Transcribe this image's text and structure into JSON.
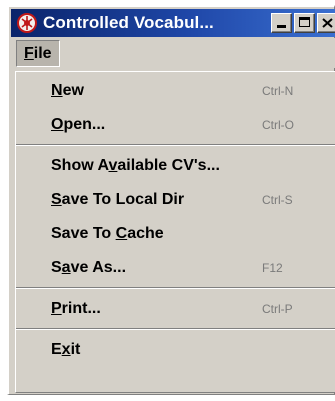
{
  "window": {
    "title": "Controlled Vocabul...",
    "colors": {
      "titlebar": "#0a246a",
      "face": "#d4d0c8",
      "accelerator": "#7a7a7a"
    }
  },
  "menubar": {
    "file_menu": {
      "before": "",
      "mnemonic": "F",
      "after": "ile"
    }
  },
  "file_menu_items": [
    {
      "before": "",
      "mnemonic": "N",
      "after": "ew",
      "accelerator": "Ctrl-N"
    },
    {
      "before": "",
      "mnemonic": "O",
      "after": "pen...",
      "accelerator": "Ctrl-O"
    },
    {
      "before": "Show A",
      "mnemonic": "v",
      "after": "ailable CV's...",
      "accelerator": ""
    },
    {
      "before": "",
      "mnemonic": "S",
      "after": "ave To Local Dir",
      "accelerator": "Ctrl-S"
    },
    {
      "before": "Save To ",
      "mnemonic": "C",
      "after": "ache",
      "accelerator": ""
    },
    {
      "before": "S",
      "mnemonic": "a",
      "after": "ve As...",
      "accelerator": "F12"
    },
    {
      "before": "",
      "mnemonic": "P",
      "after": "rint...",
      "accelerator": "Ctrl-P"
    },
    {
      "before": "E",
      "mnemonic": "x",
      "after": "it",
      "accelerator": ""
    }
  ],
  "icons": {
    "app": "app-icon",
    "minimize": "minimize-icon",
    "maximize": "maximize-icon",
    "close": "close-icon"
  }
}
